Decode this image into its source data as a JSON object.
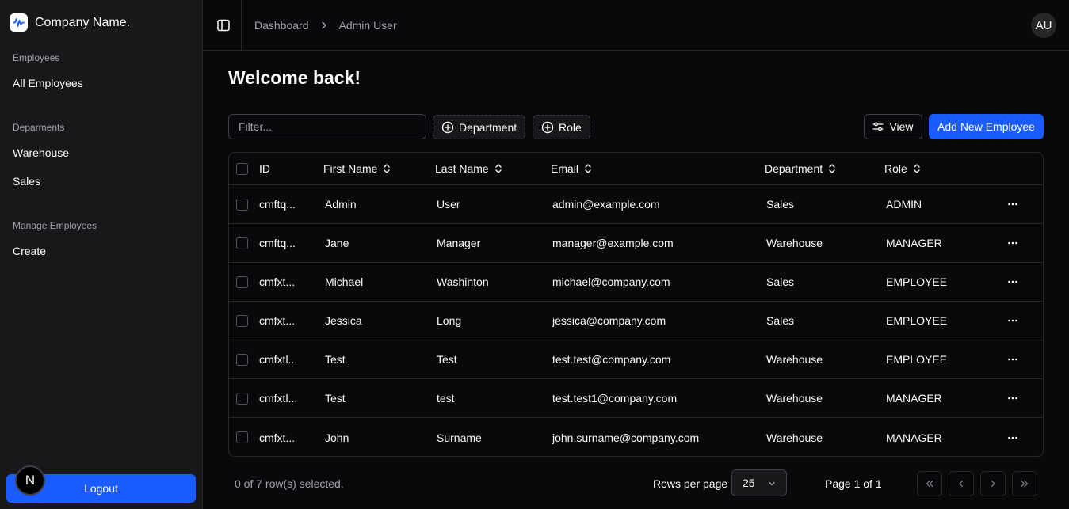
{
  "brand": {
    "name": "Company Name.",
    "logo_icon": "waveform-icon"
  },
  "sidebar": {
    "groups": [
      {
        "label": "Employees",
        "items": [
          {
            "label": "All Employees"
          }
        ]
      },
      {
        "label": "Deparments",
        "items": [
          {
            "label": "Warehouse"
          },
          {
            "label": "Sales"
          }
        ]
      },
      {
        "label": "Manage Employees",
        "items": [
          {
            "label": "Create"
          }
        ]
      }
    ],
    "logout_label": "Logout",
    "n_badge": "N"
  },
  "header": {
    "breadcrumb": [
      "Dashboard",
      "Admin User"
    ],
    "avatar_initials": "AU"
  },
  "main": {
    "title": "Welcome back!",
    "filter_placeholder": "Filter...",
    "facet_department": "Department",
    "facet_role": "Role",
    "view_label": "View",
    "add_label": "Add New Employee"
  },
  "table": {
    "columns": [
      "ID",
      "First Name",
      "Last Name",
      "Email",
      "Department",
      "Role"
    ],
    "rows": [
      {
        "id": "cmftq...",
        "first": "Admin",
        "last": "User",
        "email": "admin@example.com",
        "dept": "Sales",
        "role": "ADMIN"
      },
      {
        "id": "cmftq...",
        "first": "Jane",
        "last": "Manager",
        "email": "manager@example.com",
        "dept": "Warehouse",
        "role": "MANAGER"
      },
      {
        "id": "cmfxt...",
        "first": "Michael",
        "last": "Washinton",
        "email": "michael@company.com",
        "dept": "Sales",
        "role": "EMPLOYEE"
      },
      {
        "id": "cmfxt...",
        "first": "Jessica",
        "last": "Long",
        "email": "jessica@company.com",
        "dept": "Sales",
        "role": "EMPLOYEE"
      },
      {
        "id": "cmfxtl...",
        "first": "Test",
        "last": "Test",
        "email": "test.test@company.com",
        "dept": "Warehouse",
        "role": "EMPLOYEE"
      },
      {
        "id": "cmfxtl...",
        "first": "Test",
        "last": "test",
        "email": "test.test1@company.com",
        "dept": "Warehouse",
        "role": "MANAGER"
      },
      {
        "id": "cmfxt...",
        "first": "John",
        "last": "Surname",
        "email": "john.surname@company.com",
        "dept": "Warehouse",
        "role": "MANAGER"
      }
    ],
    "row_actions_icon": "more-horizontal-icon"
  },
  "footer": {
    "selection": "0 of 7 row(s) selected.",
    "rows_per_page_label": "Rows per page",
    "rows_per_page_value": "25",
    "page_info": "Page 1 of 1"
  },
  "colors": {
    "accent": "#1a5cff",
    "background": "#09090b",
    "sidebar": "#18181b",
    "border": "#27272a"
  }
}
